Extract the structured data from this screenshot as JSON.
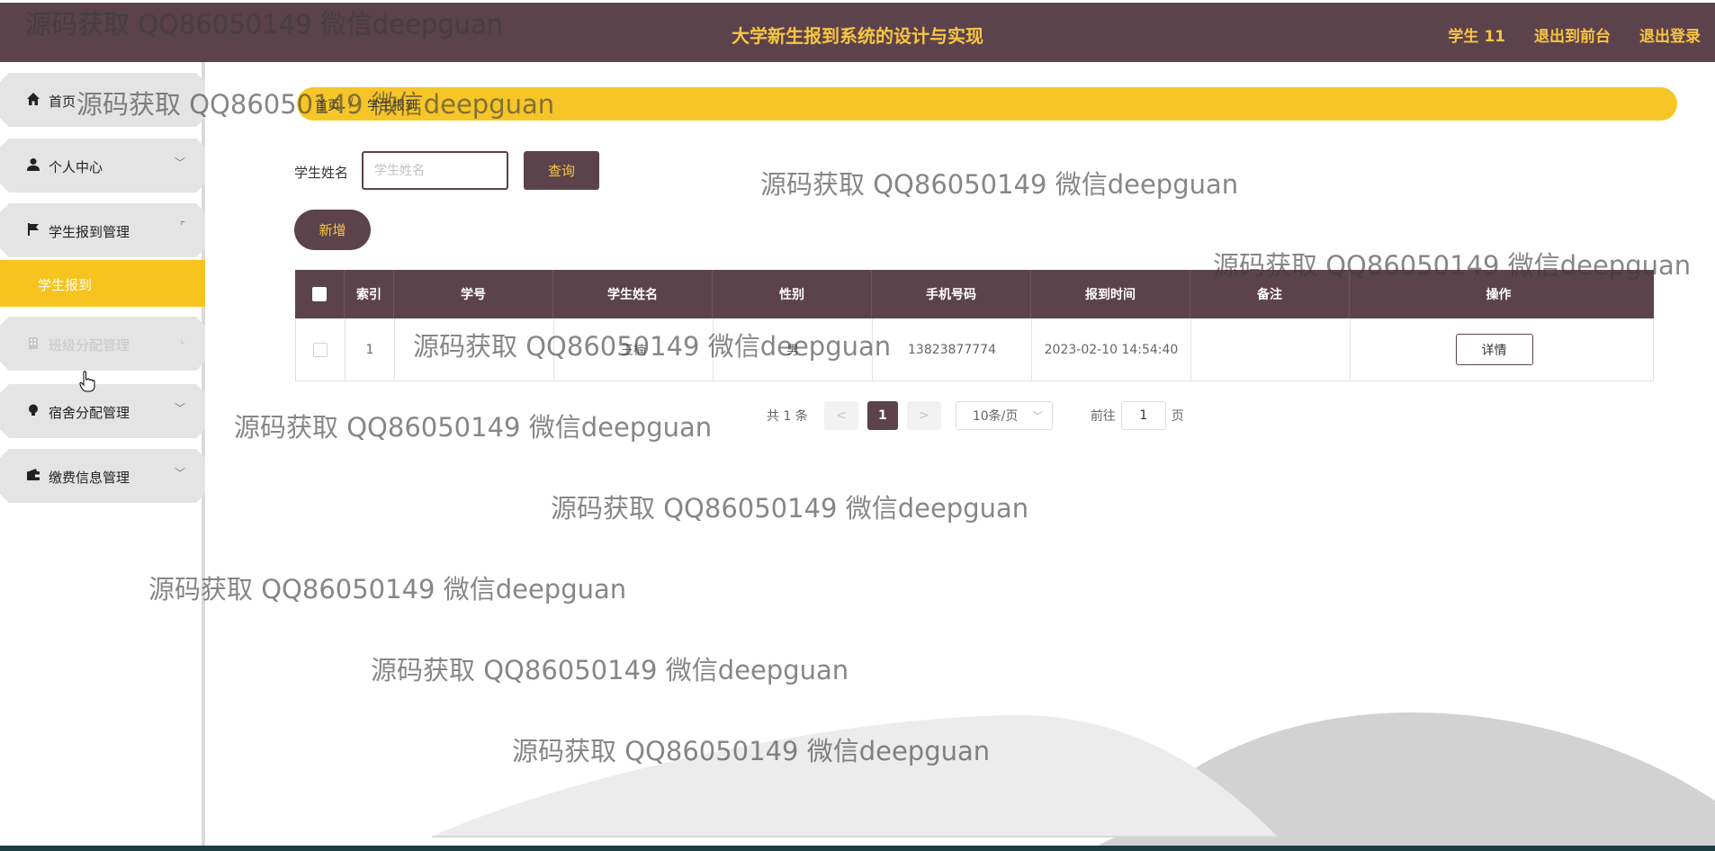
{
  "header": {
    "title": "大学新生报到系统的设计与实现",
    "user": "学生 11",
    "to_front": "退出到前台",
    "logout": "退出登录"
  },
  "sidebar": {
    "items": [
      {
        "label": "首页",
        "icon": "home-icon"
      },
      {
        "label": "个人中心",
        "icon": "user-icon"
      },
      {
        "label": "学生报到管理",
        "icon": "flag-icon"
      },
      {
        "label": "班级分配管理",
        "icon": "building-icon"
      },
      {
        "label": "宿舍分配管理",
        "icon": "bulb-icon"
      },
      {
        "label": "缴费信息管理",
        "icon": "wallet-icon"
      }
    ],
    "active_sub": "学生报到"
  },
  "breadcrumb": {
    "home": "首页",
    "current": "学生报到"
  },
  "search": {
    "label": "学生姓名",
    "placeholder": "学生姓名",
    "button": "查询"
  },
  "actions": {
    "add": "新增"
  },
  "table": {
    "columns": [
      "索引",
      "学号",
      "学生姓名",
      "性别",
      "手机号码",
      "报到时间",
      "备注",
      "操作"
    ],
    "rows": [
      {
        "index": "1",
        "student_no": "",
        "name": "王楠",
        "gender": "男",
        "phone": "13823877774",
        "report_time": "2023-02-10 14:54:40",
        "remark": "",
        "action": "详情"
      }
    ]
  },
  "pagination": {
    "total": "共 1 条",
    "prev": "<",
    "current": "1",
    "next": ">",
    "page_size": "10条/页",
    "goto_label": "前往",
    "goto_value": "1",
    "page_suffix": "页"
  },
  "watermark": "源码获取 QQ86050149 微信deepguan",
  "colors": {
    "primary": "#5b424b",
    "accent": "#f7c544",
    "breadcrumb_bg": "#f6c628",
    "active_menu": "#f7c41f"
  }
}
